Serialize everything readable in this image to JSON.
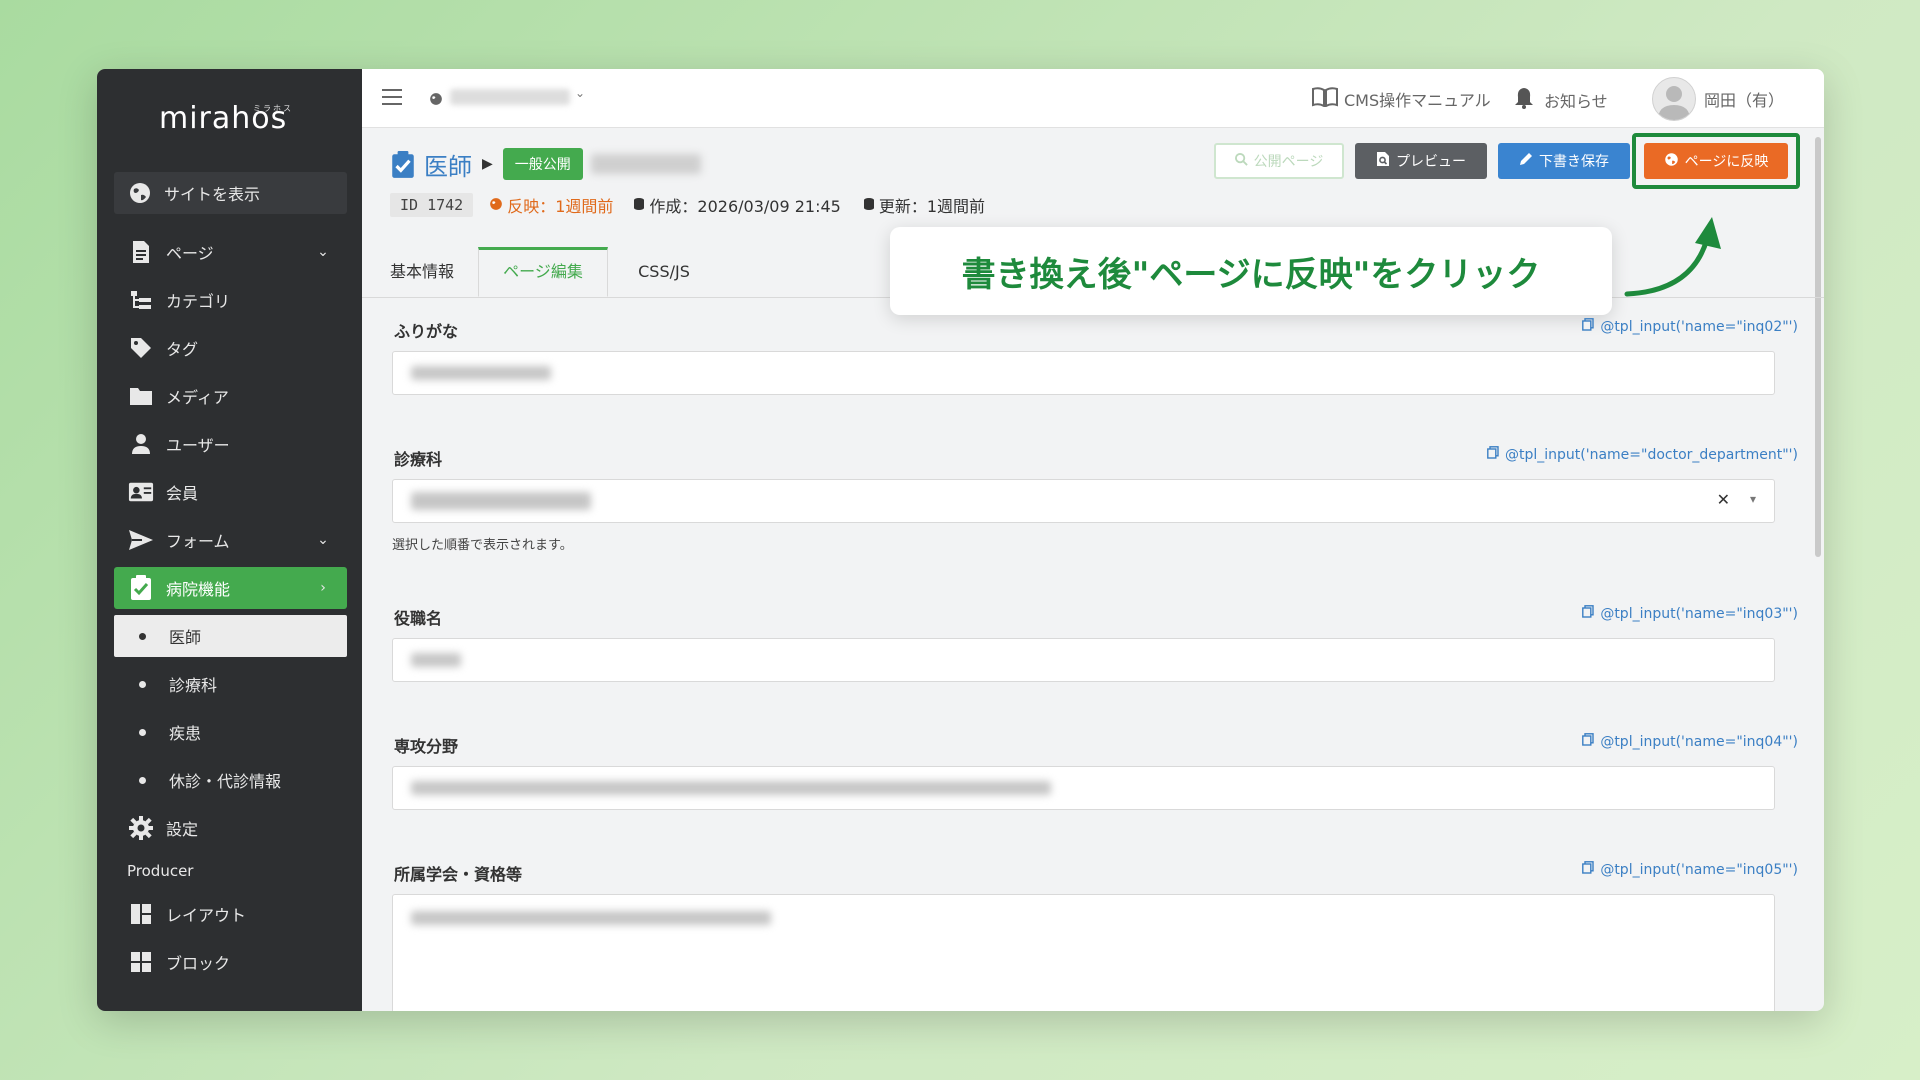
{
  "app": {
    "logo": "mirahos",
    "logo_sub": "ミラホス"
  },
  "sidebar": {
    "site_link": "サイトを表示",
    "items": [
      {
        "label": "ページ",
        "icon": "page-icon",
        "has_chevron": true
      },
      {
        "label": "カテゴリ",
        "icon": "category-tree-icon"
      },
      {
        "label": "タグ",
        "icon": "tag-icon"
      },
      {
        "label": "メディア",
        "icon": "folder-icon"
      },
      {
        "label": "ユーザー",
        "icon": "user-icon"
      },
      {
        "label": "会員",
        "icon": "member-card-icon"
      },
      {
        "label": "フォーム",
        "icon": "send-icon",
        "has_chevron": true
      },
      {
        "label": "病院機能",
        "icon": "clipboard-check-icon",
        "active": true
      },
      {
        "label": "医師",
        "sub": true,
        "current": true
      },
      {
        "label": "診療科",
        "sub": true
      },
      {
        "label": "疾患",
        "sub": true
      },
      {
        "label": "休診・代診情報",
        "sub": true
      },
      {
        "label": "設定",
        "icon": "gear-icon"
      }
    ],
    "section_producer": "Producer",
    "producer_items": [
      {
        "label": "レイアウト",
        "icon": "layout-icon"
      },
      {
        "label": "ブロック",
        "icon": "block-icon"
      }
    ]
  },
  "topbar": {
    "manual": "CMS操作マニュアル",
    "notice": "お知らせ",
    "user": "岡田（有）"
  },
  "page": {
    "title": "医師",
    "badge": "一般公開",
    "id": "ID 1742",
    "reflected": "反映：1週間前",
    "created": "作成：2026/03/09 21:45",
    "updated": "更新：1週間前"
  },
  "buttons": {
    "public_page": "公開ページ",
    "preview": "プレビュー",
    "draft": "下書き保存",
    "reflect": "ページに反映"
  },
  "tabs": [
    "基本情報",
    "ページ編集",
    "CSS/JS"
  ],
  "callout": "書き換え後\"ページに反映\"をクリック",
  "fields": [
    {
      "label": "ふりがな",
      "code": "@tpl_input('name=\"inq02\"')"
    },
    {
      "label": "診療科",
      "code": "@tpl_input('name=\"doctor_department\"')",
      "help": "選択した順番で表示されます。"
    },
    {
      "label": "役職名",
      "code": "@tpl_input('name=\"inq03\"')"
    },
    {
      "label": "専攻分野",
      "code": "@tpl_input('name=\"inq04\"')"
    },
    {
      "label": "所属学会・資格等",
      "code": "@tpl_input('name=\"inq05\"')"
    }
  ],
  "colors": {
    "accent_green": "#44aa4e",
    "reflect_orange": "#ea6a25",
    "draft_blue": "#3a84d0",
    "highlight_green": "#1e8a3c"
  }
}
